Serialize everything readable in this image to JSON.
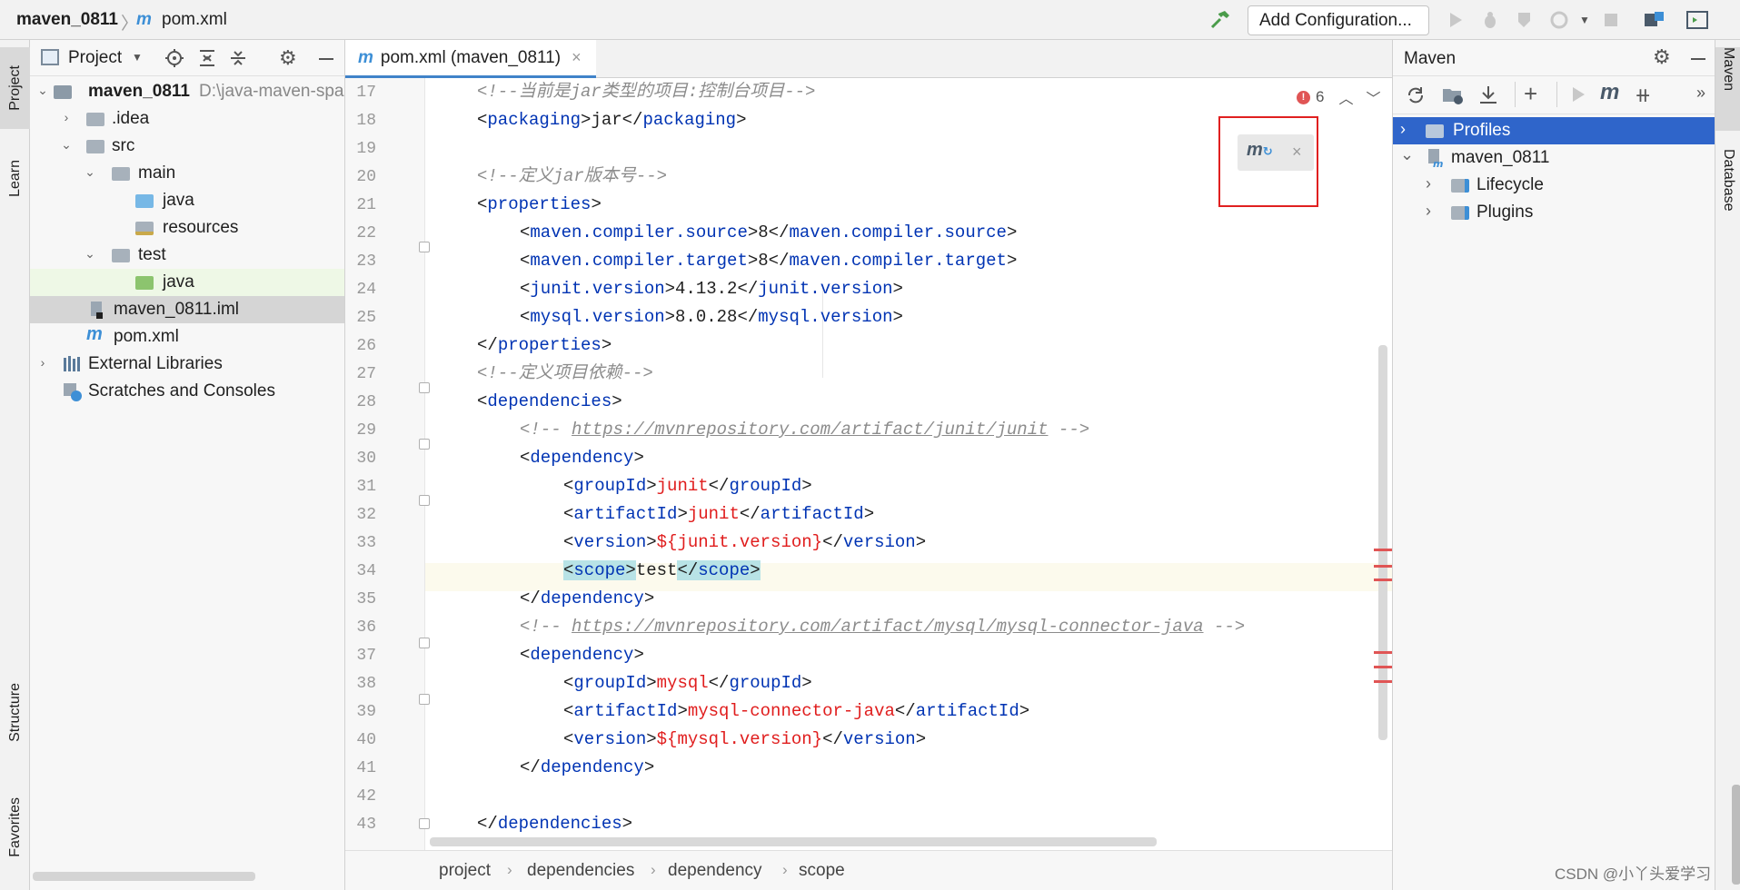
{
  "navbar": {
    "project": "maven_0811",
    "file": "pom.xml",
    "add_configuration": "Add Configuration..."
  },
  "left_stripe": {
    "project": "Project",
    "learn": "Learn",
    "structure": "Structure",
    "favorites": "Favorites"
  },
  "right_stripe": {
    "maven": "Maven",
    "database": "Database"
  },
  "project_panel": {
    "title": "Project",
    "tree": [
      {
        "label": "maven_0811",
        "extra": "D:\\java-maven-spa"
      },
      {
        "label": ".idea"
      },
      {
        "label": "src"
      },
      {
        "label": "main"
      },
      {
        "label": "java"
      },
      {
        "label": "resources"
      },
      {
        "label": "test"
      },
      {
        "label": "java"
      },
      {
        "label": "maven_0811.iml"
      },
      {
        "label": "pom.xml"
      },
      {
        "label": "External Libraries"
      },
      {
        "label": "Scratches and Consoles"
      }
    ]
  },
  "editor": {
    "tab_label": "pom.xml (maven_0811)",
    "error_count": "6",
    "line_numbers": [
      "17",
      "18",
      "19",
      "20",
      "21",
      "22",
      "23",
      "24",
      "25",
      "26",
      "27",
      "28",
      "29",
      "30",
      "31",
      "32",
      "33",
      "34",
      "35",
      "36",
      "37",
      "38",
      "39",
      "40",
      "41",
      "42",
      "43"
    ],
    "code": {
      "l17": "<!--当前是jar类型的项目:控制台项目-->",
      "l18_open": "<",
      "l18_tag": "packaging",
      "l18_text": "jar",
      "l18_close": "packaging",
      "l20": "<!--定义jar版本号-->",
      "l21_tag": "properties",
      "l22_tag": "maven.compiler.source",
      "l22_text": "8",
      "l23_tag": "maven.compiler.target",
      "l23_text": "8",
      "l24_tag": "junit.version",
      "l24_text": "4.13.2",
      "l25_tag": "mysql.version",
      "l25_text": "8.0.28",
      "l26_tag": "properties",
      "l27": "<!--定义项目依赖-->",
      "l28_tag": "dependencies",
      "l29_pre": "<!-- ",
      "l29_url": "https://mvnrepository.com/artifact/junit/junit",
      "l29_post": " -->",
      "l30_tag": "dependency",
      "l31_tag": "groupId",
      "l31_text": "junit",
      "l32_tag": "artifactId",
      "l32_text": "junit",
      "l33_tag": "version",
      "l33_text": "${junit.version}",
      "l34_tag": "scope",
      "l34_text": "test",
      "l35_tag": "dependency",
      "l36_pre": "<!-- ",
      "l36_url": "https://mvnrepository.com/artifact/mysql/mysql-connector-java",
      "l36_post": " -->",
      "l37_tag": "dependency",
      "l38_tag": "groupId",
      "l38_text": "mysql",
      "l39_tag": "artifactId",
      "l39_text": "mysql-connector-java",
      "l40_tag": "version",
      "l40_text": "${mysql.version}",
      "l41_tag": "dependency",
      "l43_tag": "dependencies"
    },
    "breadcrumbs": [
      "project",
      "dependencies",
      "dependency",
      "scope"
    ]
  },
  "maven_panel": {
    "title": "Maven",
    "tree": [
      {
        "label": "Profiles"
      },
      {
        "label": "maven_0811"
      },
      {
        "label": "Lifecycle"
      },
      {
        "label": "Plugins"
      }
    ]
  },
  "watermark": "CSDN @小丫头爱学习",
  "colors": {
    "accent": "#2f65ca",
    "selection": "#2f65ca",
    "tag": "#0033b3",
    "value_red": "#e01d1d",
    "annotation_red": "#e02020"
  }
}
